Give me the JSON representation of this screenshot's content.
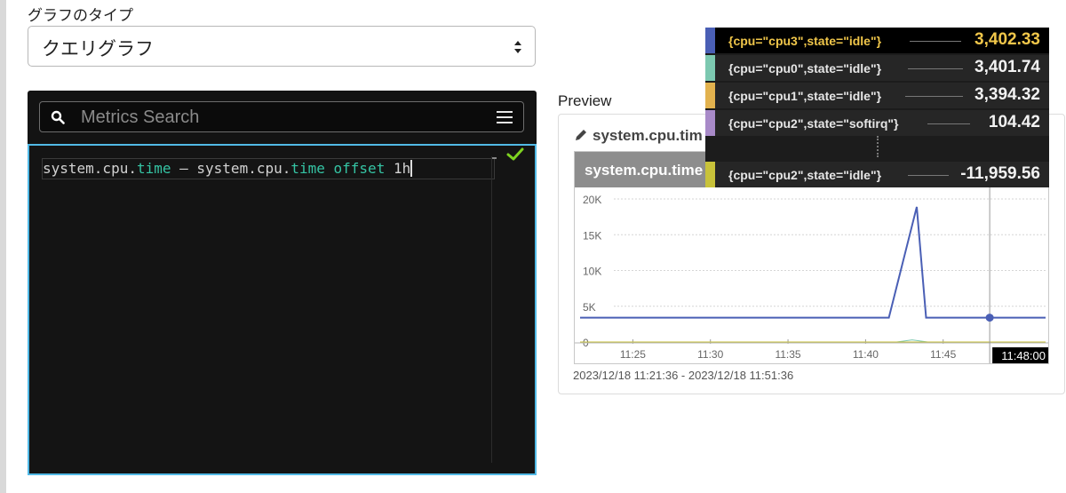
{
  "graph_type": {
    "label": "グラフのタイプ",
    "selected": "クエリグラフ"
  },
  "metrics_search": {
    "placeholder": "Metrics Search"
  },
  "query": {
    "part1": "system.cpu.",
    "kw1": "time",
    "part2": " – system.cpu.",
    "kw2": "time",
    "kw3": " offset",
    "part3": " 1h"
  },
  "preview": {
    "label": "Preview",
    "card_title": "system.cpu.tim",
    "panel_title": "system.cpu.time",
    "time_range": "2023/12/18 11:21:36 - 2023/12/18 11:51:36",
    "crosshair_time": "11:48:00"
  },
  "tooltip": {
    "rows": [
      {
        "name": "{cpu=\"cpu3\",state=\"idle\"}",
        "value": "3,402.33",
        "color": "#4a5fb5",
        "highlighted": true
      },
      {
        "name": "{cpu=\"cpu0\",state=\"idle\"}",
        "value": "3,401.74",
        "color": "#7cc8b0",
        "highlighted": false
      },
      {
        "name": "{cpu=\"cpu1\",state=\"idle\"}",
        "value": "3,394.32",
        "color": "#e2b24e",
        "highlighted": false
      },
      {
        "name": "{cpu=\"cpu2\",state=\"softirq\"}",
        "value": "104.42",
        "color": "#a88ac8",
        "highlighted": false
      },
      {
        "name": "{cpu=\"cpu2\",state=\"idle\"}",
        "value": "-11,959.56",
        "color": "#c8c23a",
        "highlighted": false
      }
    ]
  },
  "chart_data": {
    "type": "line",
    "y_ticks": [
      "20K",
      "15K",
      "10K",
      "5K",
      "0"
    ],
    "x_ticks": [
      "11:25",
      "11:30",
      "11:35",
      "11:40",
      "11:45"
    ],
    "ylim": [
      -500,
      21000
    ],
    "xlim_minutes": [
      21.6,
      51.6
    ],
    "grid": true,
    "series": [
      {
        "color": "#4a5fb5",
        "x": [
          21.6,
          41.5,
          43.3,
          43.9,
          45.5,
          51.6
        ],
        "y": [
          3400,
          3400,
          18900,
          3400,
          3400,
          3400
        ]
      },
      {
        "color": "#c8c23a",
        "x": [
          21.6,
          48.0,
          51.6
        ],
        "y": [
          0,
          0,
          0
        ]
      },
      {
        "color": "#7cc8b0",
        "x": [
          21.6,
          42.0,
          43.0,
          44.0,
          51.6
        ],
        "y": [
          0,
          0,
          300,
          0,
          0
        ]
      }
    ],
    "marker": {
      "x": 48.0,
      "y": 3402.33
    }
  }
}
